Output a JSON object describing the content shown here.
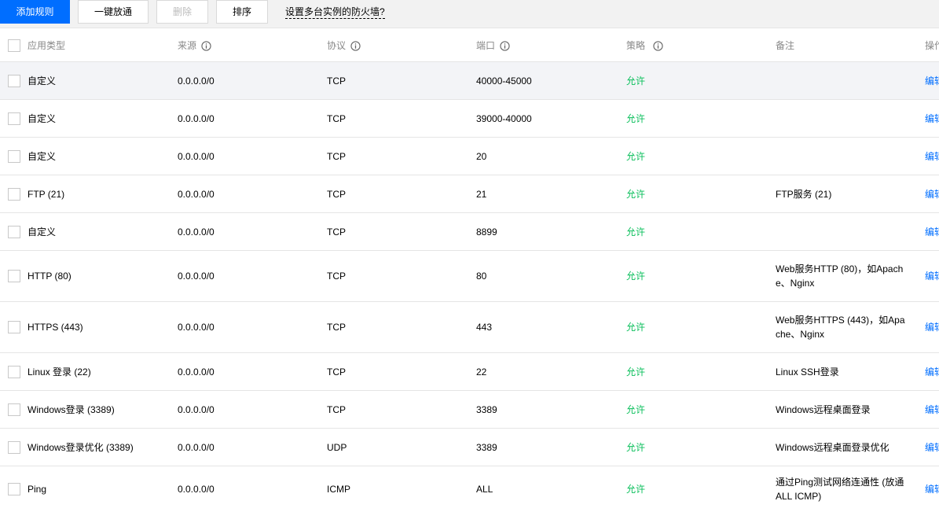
{
  "toolbar": {
    "add_rule": "添加规则",
    "one_click_open": "一键放通",
    "delete": "删除",
    "sort": "排序",
    "help_link": "设置多台实例的防火墙?"
  },
  "table": {
    "headers": {
      "type": "应用类型",
      "source": "来源",
      "protocol": "协议",
      "port": "端口",
      "policy": "策略",
      "note": "备注",
      "operation": "操作"
    },
    "rows": [
      {
        "type": "自定义",
        "source": "0.0.0.0/0",
        "protocol": "TCP",
        "port": "40000-45000",
        "policy": "允许",
        "note": "",
        "operation": "编辑"
      },
      {
        "type": "自定义",
        "source": "0.0.0.0/0",
        "protocol": "TCP",
        "port": "39000-40000",
        "policy": "允许",
        "note": "",
        "operation": "编辑"
      },
      {
        "type": "自定义",
        "source": "0.0.0.0/0",
        "protocol": "TCP",
        "port": "20",
        "policy": "允许",
        "note": "",
        "operation": "编辑"
      },
      {
        "type": "FTP (21)",
        "source": "0.0.0.0/0",
        "protocol": "TCP",
        "port": "21",
        "policy": "允许",
        "note": "FTP服务 (21)",
        "operation": "编辑"
      },
      {
        "type": "自定义",
        "source": "0.0.0.0/0",
        "protocol": "TCP",
        "port": "8899",
        "policy": "允许",
        "note": "",
        "operation": "编辑"
      },
      {
        "type": "HTTP (80)",
        "source": "0.0.0.0/0",
        "protocol": "TCP",
        "port": "80",
        "policy": "允许",
        "note": "Web服务HTTP (80)，如Apache、Nginx",
        "operation": "编辑"
      },
      {
        "type": "HTTPS (443)",
        "source": "0.0.0.0/0",
        "protocol": "TCP",
        "port": "443",
        "policy": "允许",
        "note": "Web服务HTTPS (443)，如Apache、Nginx",
        "operation": "编辑"
      },
      {
        "type": "Linux 登录 (22)",
        "source": "0.0.0.0/0",
        "protocol": "TCP",
        "port": "22",
        "policy": "允许",
        "note": "Linux SSH登录",
        "operation": "编辑"
      },
      {
        "type": "Windows登录 (3389)",
        "source": "0.0.0.0/0",
        "protocol": "TCP",
        "port": "3389",
        "policy": "允许",
        "note": "Windows远程桌面登录",
        "operation": "编辑"
      },
      {
        "type": "Windows登录优化 (3389)",
        "source": "0.0.0.0/0",
        "protocol": "UDP",
        "port": "3389",
        "policy": "允许",
        "note": "Windows远程桌面登录优化",
        "operation": "编辑"
      },
      {
        "type": "Ping",
        "source": "0.0.0.0/0",
        "protocol": "ICMP",
        "port": "ALL",
        "policy": "允许",
        "note": "通过Ping测试网络连通性 (放通ALL ICMP)",
        "operation": "编辑"
      }
    ]
  },
  "colors": {
    "primary": "#006eff",
    "allow": "#0abf5b",
    "header_text": "#888888",
    "row_hover": "#f3f4f7"
  }
}
